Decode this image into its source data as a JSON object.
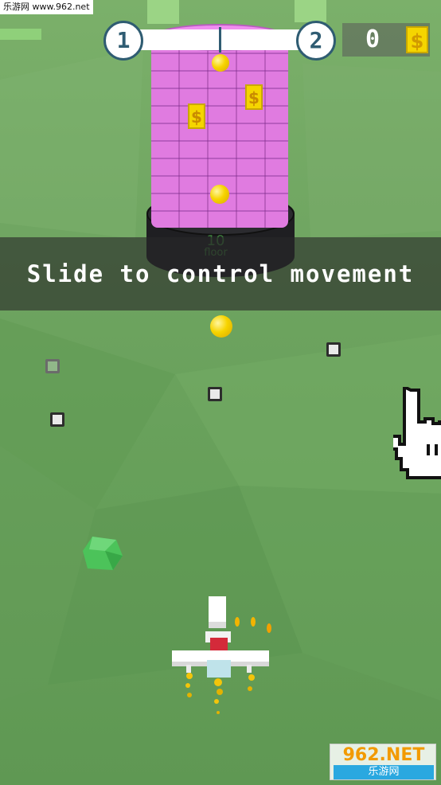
{
  "watermark_top": "乐游网 www.962.net",
  "level": {
    "current": "1",
    "next": "2",
    "progress": 0.5
  },
  "coins": {
    "count": "0",
    "icon_glyph": "$",
    "icon": "dollar-coin-icon"
  },
  "tower": {
    "floor_number": "10",
    "floor_word": "floor",
    "coin_glyph": "$"
  },
  "tutorial": {
    "text": "Slide to control movement"
  },
  "watermark_bottom": {
    "brand": "962.NET",
    "cn": "乐游网"
  },
  "colors": {
    "ground": "#6ea460",
    "tower_brick": "#e07be0",
    "coin_yellow": "#f5d500",
    "level_bar_accent": "#2f5c72",
    "banner_bg": "rgba(40,40,40,0.62)"
  }
}
